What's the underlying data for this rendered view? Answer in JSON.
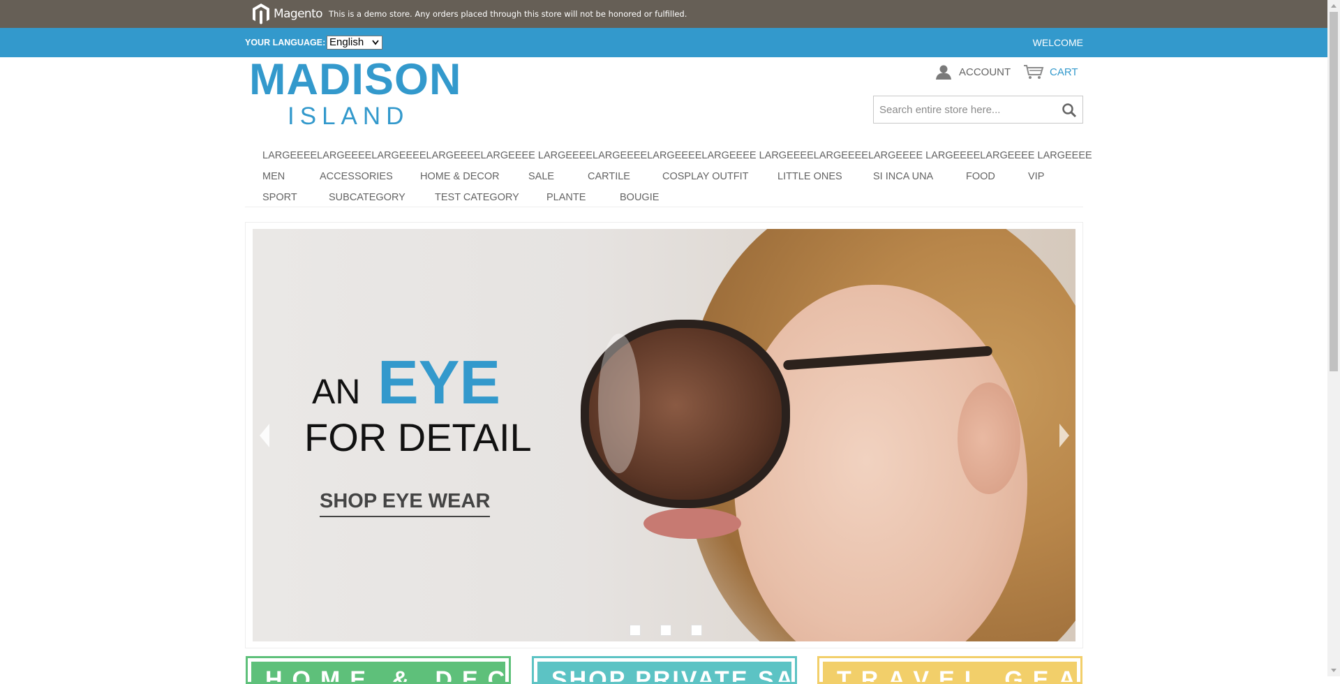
{
  "demo_notice": {
    "brand": "Magento",
    "text": "This is a demo store. Any orders placed through this store will not be honored or fulfilled."
  },
  "language_bar": {
    "label": "YOUR LANGUAGE:",
    "selected": "English",
    "welcome": "WELCOME"
  },
  "header": {
    "logo_line1": "MADISON",
    "logo_line2": "ISLAND",
    "account_label": "ACCOUNT",
    "cart_label": "CART",
    "search_placeholder": "Search entire store here..."
  },
  "nav": {
    "rows": [
      [
        "LARGEEEELARGEEEELARGEEEELARGEEEELARGEEEE LARGEEEELARGEEEELARGEEEELARGEEEE LARGEEEELARGEEEELARGEEEE LARGEEEELARGEEEE LARGEEEE"
      ],
      [
        "MEN",
        "ACCESSORIES",
        "HOME & DECOR",
        "SALE",
        "CARTILE",
        "COSPLAY OUTFIT",
        "LITTLE ONES",
        "SI INCA UNA",
        "FOOD",
        "VIP"
      ],
      [
        "SPORT",
        "SUBCATEGORY",
        "TEST CATEGORY",
        "PLANTE",
        "BOUGIE"
      ]
    ]
  },
  "hero": {
    "line_an": "AN",
    "line_eye": "EYE",
    "line_detail": "FOR DETAIL",
    "cta": "SHOP EYE WEAR",
    "slide_count": 3,
    "active_slide": 1
  },
  "promos": [
    {
      "label": "HOME & DECOR",
      "color": "#5ec07a"
    },
    {
      "label": "SHOP PRIVATE SALES",
      "color": "#5cc3c4"
    },
    {
      "label": "TRAVEL GEAR",
      "color": "#f2cf6a"
    }
  ],
  "colors": {
    "demo_bar": "#665f56",
    "accent": "#3399cc",
    "text": "#636363"
  }
}
